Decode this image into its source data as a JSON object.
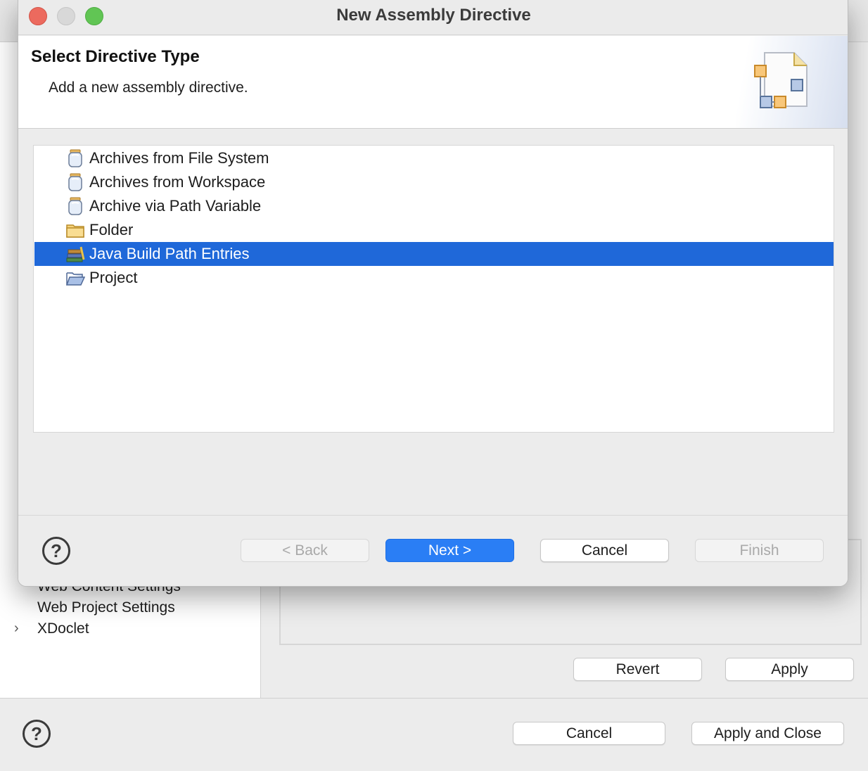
{
  "dialog": {
    "title": "New Assembly Directive",
    "header_title": "Select Directive Type",
    "header_description": "Add a new assembly directive.",
    "list_items": [
      {
        "label": "Archives from File System",
        "icon": "jar-icon",
        "selected": false
      },
      {
        "label": "Archives from Workspace",
        "icon": "jar-icon",
        "selected": false
      },
      {
        "label": "Archive via Path Variable",
        "icon": "jar-icon",
        "selected": false
      },
      {
        "label": "Folder",
        "icon": "folder-icon",
        "selected": false
      },
      {
        "label": "Java Build Path Entries",
        "icon": "library-icon",
        "selected": true
      },
      {
        "label": "Project",
        "icon": "open-folder-icon",
        "selected": false
      }
    ],
    "buttons": {
      "back": "< Back",
      "next": "Next >",
      "cancel": "Cancel",
      "finish": "Finish"
    },
    "help_symbol": "?"
  },
  "background": {
    "tree_items": [
      "Web Content Settings",
      "Web Project Settings",
      "XDoclet"
    ],
    "revert_label": "Revert",
    "apply_label": "Apply",
    "cancel_label": "Cancel",
    "apply_close_label": "Apply and Close",
    "help_symbol": "?",
    "expand_symbol": "›"
  },
  "colors": {
    "selection": "#1f68d9",
    "default_button": "#2a7ef5",
    "close": "#ec6a5e",
    "maximize": "#61c554"
  }
}
